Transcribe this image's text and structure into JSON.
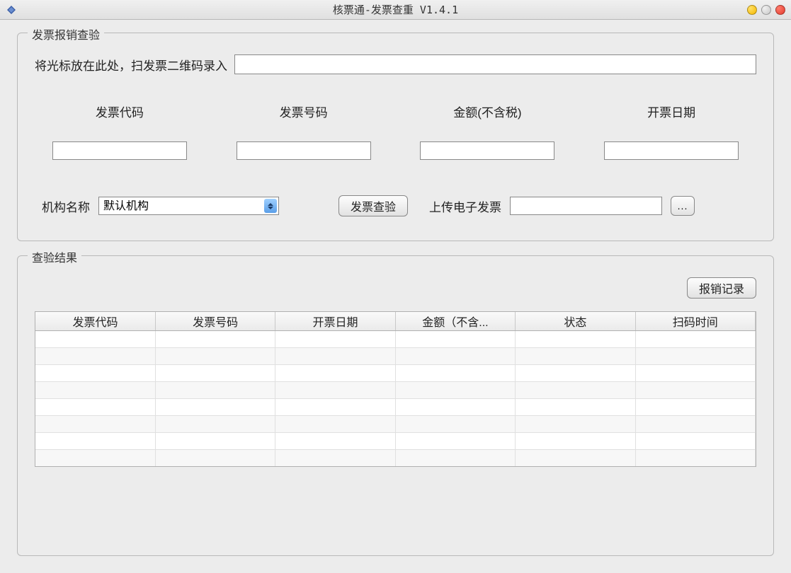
{
  "window": {
    "title": "核票通-发票查重 V1.4.1"
  },
  "groupbox_inspect": {
    "title": "发票报销查验",
    "scan_label": "将光标放在此处，扫发票二维码录入",
    "scan_value": "",
    "fields": {
      "invoice_code": {
        "label": "发票代码",
        "value": ""
      },
      "invoice_number": {
        "label": "发票号码",
        "value": ""
      },
      "amount_excl_tax": {
        "label": "金额(不含税)",
        "value": ""
      },
      "issue_date": {
        "label": "开票日期",
        "value": ""
      }
    },
    "org_label": "机构名称",
    "org_selected": "默认机构",
    "org_options": [
      "默认机构"
    ],
    "verify_button": "发票查验",
    "upload_label": "上传电子发票",
    "upload_value": "",
    "browse_button": "..."
  },
  "groupbox_result": {
    "title": "查验结果",
    "history_button": "报销记录",
    "columns": [
      "发票代码",
      "发票号码",
      "开票日期",
      "金额（不含...",
      "状态",
      "扫码时间"
    ],
    "rows": []
  }
}
